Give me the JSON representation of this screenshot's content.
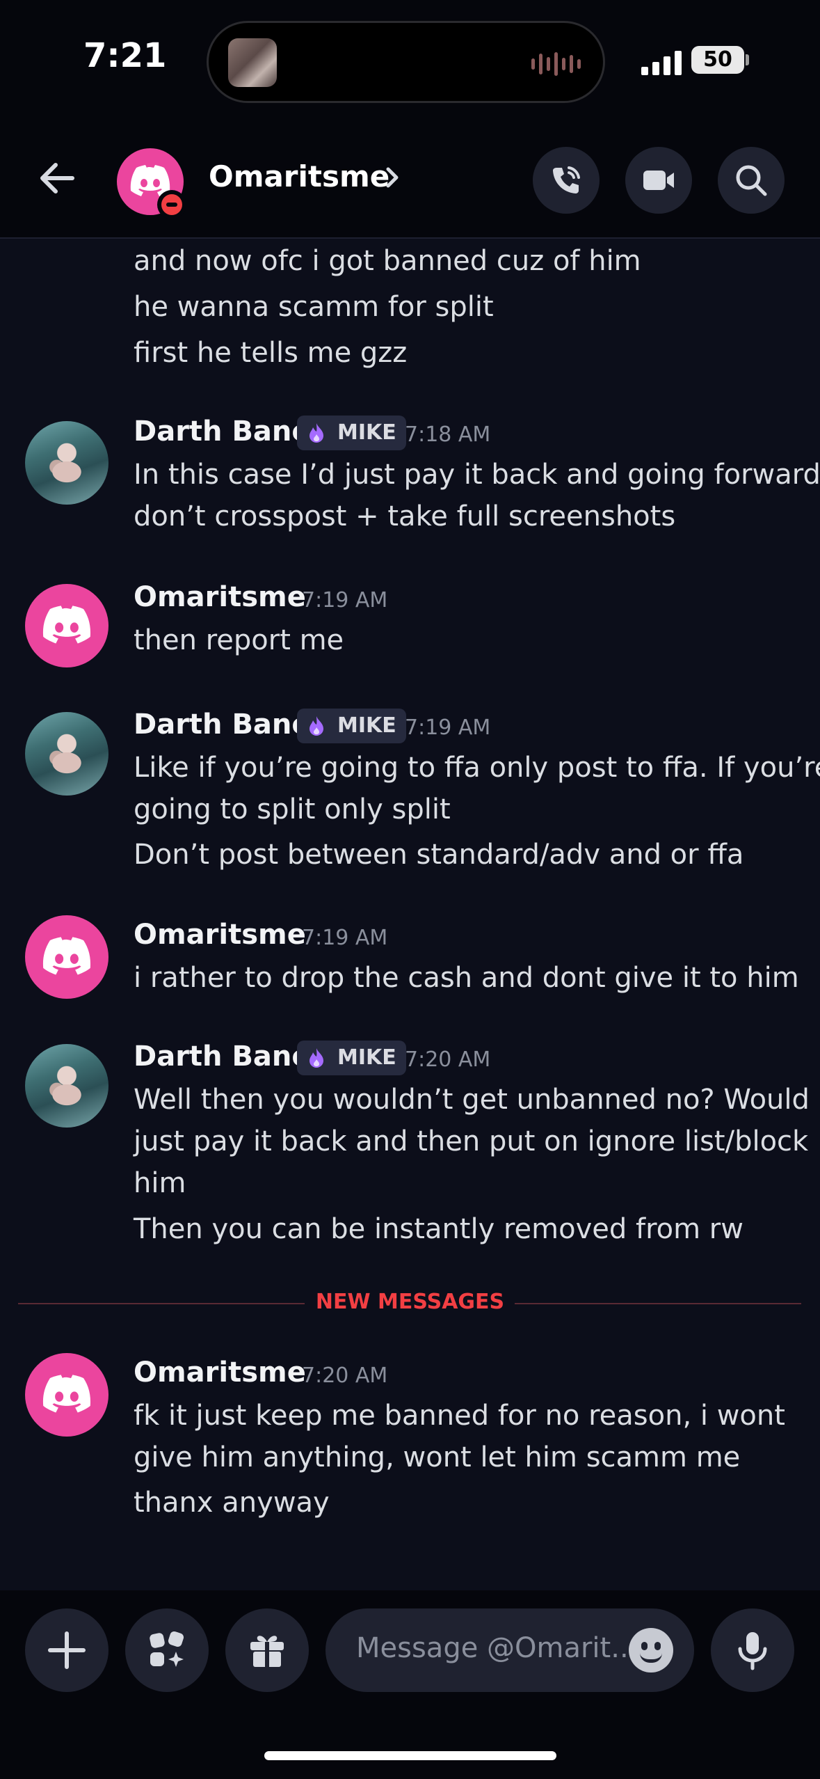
{
  "status_bar": {
    "time": "7:21",
    "battery": "50",
    "icons": [
      "signal-icon",
      "battery-icon",
      "audio-wave-icon"
    ]
  },
  "header": {
    "name": "Omaritsme",
    "status": "do-not-disturb",
    "icons": [
      "back-arrow-icon",
      "chevron-right-icon",
      "voice-call-icon",
      "video-call-icon",
      "search-icon"
    ]
  },
  "colors": {
    "accent": "#eb459e",
    "new_messages": "#f23f43",
    "background": "#0c0e1a"
  },
  "messages": [
    {
      "continuation": true,
      "lines": [
        "and now ofc i got banned cuz of him",
        "he wanna scamm for split",
        "first he tells me gzz"
      ]
    },
    {
      "author": "Darth Bane",
      "tag": "MIKE",
      "time": "7:18 AM",
      "lines": [
        "In this case I’d just pay it back and going forward,",
        "don’t crosspost + take full screenshots"
      ]
    },
    {
      "author": "Omaritsme",
      "time": "7:19 AM",
      "lines": [
        "then report me"
      ]
    },
    {
      "author": "Darth Bane",
      "tag": "MIKE",
      "time": "7:19 AM",
      "lines": [
        "Like if you’re going to ffa only post to ffa. If you’re",
        "going to split only split",
        "Don’t post between standard/adv and or ffa"
      ]
    },
    {
      "author": "Omaritsme",
      "time": "7:19 AM",
      "lines": [
        "i rather to drop the cash and dont give it to him"
      ]
    },
    {
      "author": "Darth Bane",
      "tag": "MIKE",
      "time": "7:20 AM",
      "lines": [
        "Well then you wouldn’t get unbanned no? Would",
        "just pay it back and then put on ignore list/block",
        "him",
        "Then you can be instantly removed from rw"
      ]
    },
    {
      "author": "Omaritsme",
      "time": "7:20 AM",
      "lines": [
        "fk it just keep me banned for no reason, i wont",
        "give him anything, wont let him scamm me",
        "thanx anyway"
      ]
    }
  ],
  "new_messages_label": "NEW MESSAGES",
  "composer": {
    "placeholder": "Message @Omarit..",
    "icons": [
      "plus-icon",
      "apps-icon",
      "gift-icon",
      "emoji-icon",
      "microphone-icon"
    ]
  }
}
